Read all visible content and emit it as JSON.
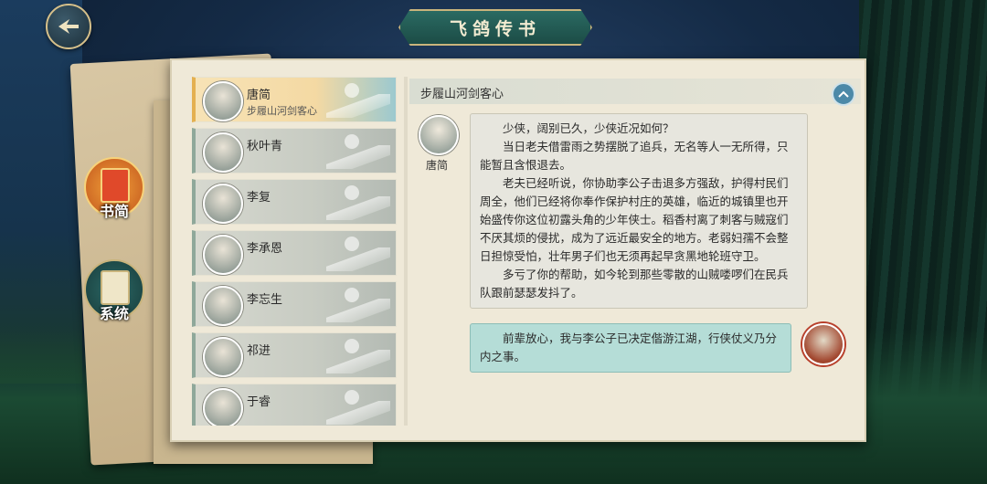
{
  "title": "飞鸽传书",
  "side_buttons": {
    "letters": "书简",
    "system": "系统"
  },
  "contacts": [
    {
      "name": "唐简",
      "subtitle": "步履山河剑客心",
      "active": true
    },
    {
      "name": "秋叶青",
      "subtitle": "",
      "active": false
    },
    {
      "name": "李复",
      "subtitle": "",
      "active": false
    },
    {
      "name": "李承恩",
      "subtitle": "",
      "active": false
    },
    {
      "name": "李忘生",
      "subtitle": "",
      "active": false
    },
    {
      "name": "祁进",
      "subtitle": "",
      "active": false
    },
    {
      "name": "于睿",
      "subtitle": "",
      "active": false
    }
  ],
  "conversation": {
    "title": "步履山河剑客心",
    "sender_name": "唐简",
    "incoming": [
      "少侠，阔别已久，少侠近况如何？",
      "当日老夫借雷雨之势摆脱了追兵，无名等人一无所得，只能暂且含恨退去。",
      "老夫已经听说，你协助李公子击退多方强敌，护得村民们周全，他们已经将你奉作保护村庄的英雄，临近的城镇里也开始盛传你这位初露头角的少年侠士。稻香村离了刺客与贼寇们不厌其烦的侵扰，成为了远近最安全的地方。老弱妇孺不会整日担惊受怕，壮年男子们也无须再起早贪黑地轮班守卫。",
      "多亏了你的帮助，如今轮到那些零散的山贼喽啰们在民兵队跟前瑟瑟发抖了。"
    ],
    "outgoing": "前辈放心，我与李公子已决定偕游江湖，行侠仗义乃分内之事。"
  },
  "colors": {
    "accent_gold": "#e4b050",
    "bubble_incoming": "#e7e6de",
    "bubble_outgoing": "#b5ddd7",
    "title_plate": "#1c4c46"
  },
  "icons": {
    "back": "back-arrow-icon",
    "collapse": "chevron-up-icon"
  }
}
